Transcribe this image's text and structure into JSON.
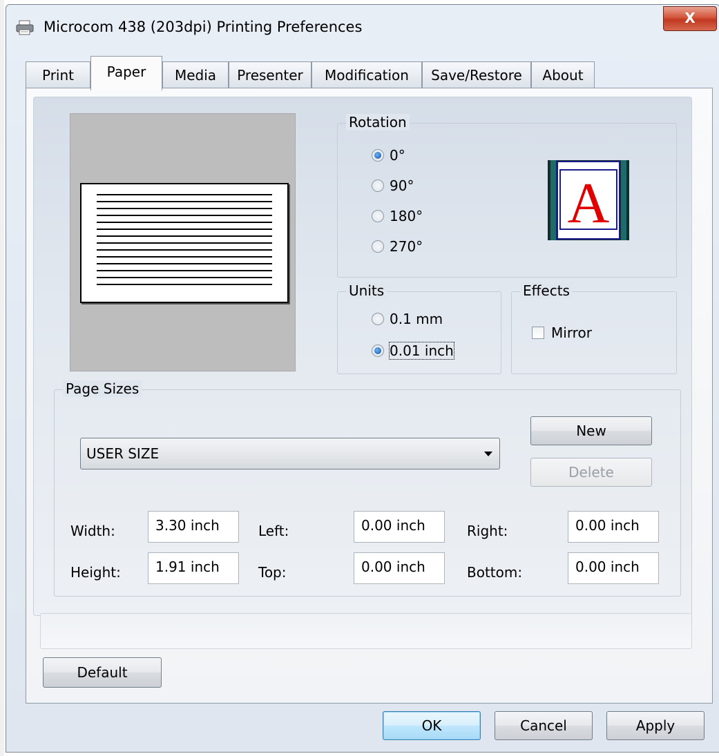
{
  "window": {
    "title": "Microcom 438 (203dpi) Printing Preferences",
    "close_glyph": "X",
    "icon": "printer-icon"
  },
  "tabs": [
    {
      "label": "Print",
      "active": false
    },
    {
      "label": "Paper",
      "active": true
    },
    {
      "label": "Media",
      "active": false
    },
    {
      "label": "Presenter",
      "active": false
    },
    {
      "label": "Modification",
      "active": false
    },
    {
      "label": "Save/Restore",
      "active": false
    },
    {
      "label": "About",
      "active": false
    }
  ],
  "rotation": {
    "legend": "Rotation",
    "options": [
      {
        "label": "0°",
        "selected": true
      },
      {
        "label": "90°",
        "selected": false
      },
      {
        "label": "180°",
        "selected": false
      },
      {
        "label": "270°",
        "selected": false
      }
    ],
    "preview_letter": "A"
  },
  "units": {
    "legend": "Units",
    "options": [
      {
        "label": "0.1 mm",
        "selected": false
      },
      {
        "label": "0.01 inch",
        "selected": true
      }
    ]
  },
  "effects": {
    "legend": "Effects",
    "mirror_label": "Mirror",
    "mirror_checked": false
  },
  "page_sizes": {
    "legend": "Page Sizes",
    "selected": "USER SIZE",
    "new_label": "New",
    "delete_label": "Delete"
  },
  "dimensions": {
    "width_label": "Width:",
    "width_value": "3.30 inch",
    "height_label": "Height:",
    "height_value": "1.91 inch",
    "left_label": "Left:",
    "left_value": "0.00 inch",
    "top_label": "Top:",
    "top_value": "0.00 inch",
    "right_label": "Right:",
    "right_value": "0.00 inch",
    "bottom_label": "Bottom:",
    "bottom_value": "0.00 inch"
  },
  "buttons": {
    "default_label": "Default",
    "ok_label": "OK",
    "cancel_label": "Cancel",
    "apply_label": "Apply"
  },
  "colors": {
    "accent_radio": "#0b4ea8",
    "rotation_letter": "#e00000",
    "close_button": "#c0381f"
  }
}
